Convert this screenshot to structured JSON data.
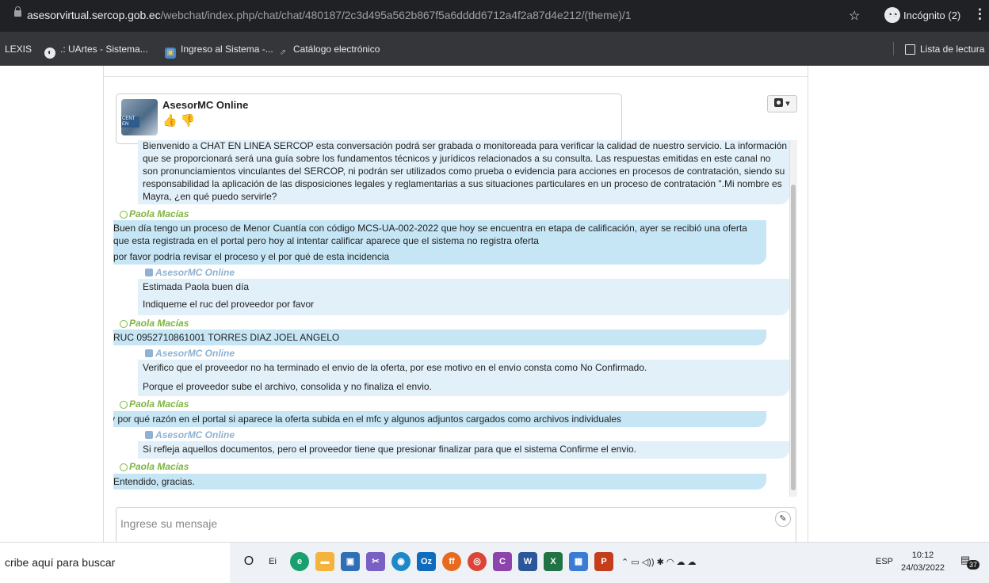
{
  "browser": {
    "url_host": "asesorvirtual.sercop.gob.ec",
    "url_path": "/webchat/index.php/chat/chat/480187/2c3d495a562b867f5a6dddd6712a4f2a87d4e212/(theme)/1",
    "incognito_label": "Incógnito (2)",
    "menu_glyph": "⋮",
    "star_glyph": "☆"
  },
  "bookmarks": {
    "items": [
      {
        "label": "LEXIS"
      },
      {
        "label": ".: UArtes - Sistema..."
      },
      {
        "label": "Ingreso al Sistema -..."
      },
      {
        "label": "Catálogo electrónico"
      }
    ],
    "reading_list": "Lista de lectura"
  },
  "chat": {
    "agent_name": "AsesorMC Online",
    "avatar_text": "CENT EN",
    "like_glyphs": "👍👎",
    "settings_caret": "▾",
    "user_name": "Paola Macías",
    "operator_name": "AsesorMC Online",
    "welcome_lines": [
      "Bienvenido a CHAT EN LINEA SERCOP esta conversación podrá ser grabada o monitoreada para verificar la calidad de nuestro servicio. La información",
      "que se proporcionará será una guía sobre los fundamentos técnicos y jurídicos relacionados a su consulta. Las respuestas emitidas en este canal no",
      "son pronunciamientos vinculantes del SERCOP, ni podrán ser utilizados como prueba o evidencia para acciones en procesos de contratación, siendo su",
      "responsabilidad la aplicación de las disposiciones legales y reglamentarias a sus situaciones particulares en un proceso de contratación \".Mi nombre es",
      "Mayra, ¿en qué puedo servirle?"
    ],
    "u1_lines": [
      "Buen día tengo un proceso de Menor Cuantía con código MCS-UA-002-2022 que hoy se encuentra en etapa de calificación, ayer se recibió una oferta",
      "que esta registrada en el portal pero hoy al intentar calificar aparece que el sistema no registra oferta",
      "por favor podría revisar el proceso y el por qué de esta incidencia"
    ],
    "o1_lines": [
      "Estimada Paola buen día",
      "Indiqueme el ruc del proveedor por favor"
    ],
    "u2_lines": [
      "RUC 0952710861001 TORRES DIAZ JOEL ANGELO"
    ],
    "o2_lines": [
      "Verifico que el proveedor no ha terminado el envio de la oferta, por ese motivo en el envio consta como No Confirmado.",
      "Porque el proveedor sube el archivo, consolida y no finaliza el envio."
    ],
    "u3_lines": [
      "y por qué razón en el portal si aparece la oferta subida en el mfc y algunos adjuntos cargados como archivos individuales"
    ],
    "o3_lines": [
      "Si refleja aquellos documentos, pero el proveedor tiene que presionar finalizar para que el sistema Confirme el envio."
    ],
    "u4_lines": [
      "Entendido, gracias."
    ],
    "input_placeholder": "Ingrese su mensaje"
  },
  "taskbar": {
    "search_text": "cribe aquí para buscar",
    "language": "ESP",
    "time": "10:12",
    "date": "24/03/2022",
    "notif_count": "37",
    "apps": [
      "O",
      "Ei",
      "e",
      "▬",
      "▣",
      "✂",
      "◉",
      "Oz",
      "ff",
      "◎",
      "C",
      "W",
      "X",
      "▦",
      "P"
    ]
  }
}
